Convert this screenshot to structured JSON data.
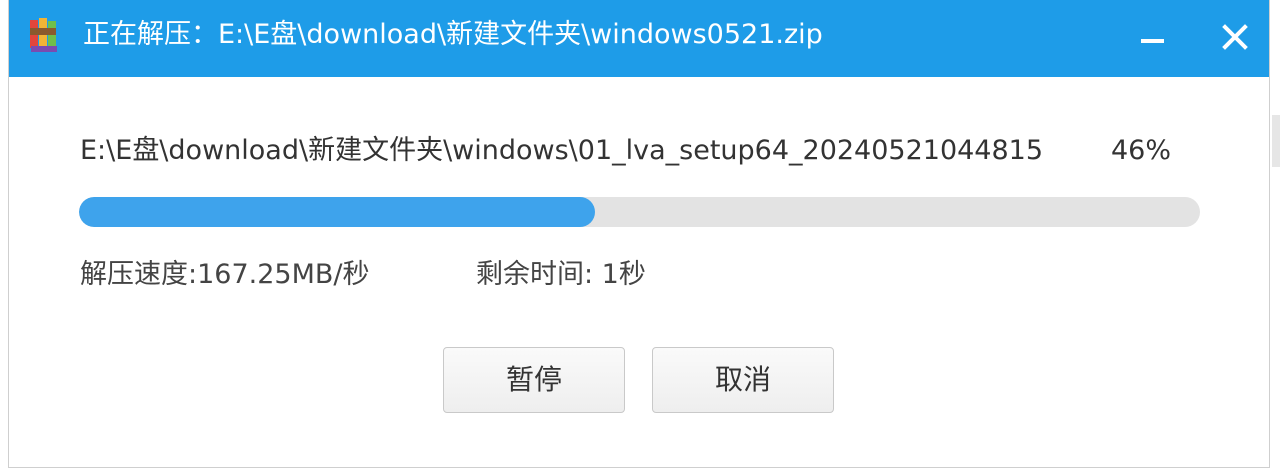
{
  "window": {
    "title": "正在解压：E:\\E盘\\download\\新建文件夹\\windows0521.zip",
    "accent_color": "#1e9ce8",
    "icons": {
      "app": "winrar-books-icon",
      "minimize": "minimize-icon",
      "close": "close-icon"
    }
  },
  "extract": {
    "current_file": "E:\\E盘\\download\\新建文件夹\\windows\\01_lva_setup64_20240521044815",
    "percent_label": "46%",
    "progress": 0.46,
    "progress_color": "#3ea3ec",
    "speed": "解压速度:167.25MB/秒",
    "remaining": "剩余时间: 1秒"
  },
  "buttons": {
    "pause": "暂停",
    "cancel": "取消"
  }
}
